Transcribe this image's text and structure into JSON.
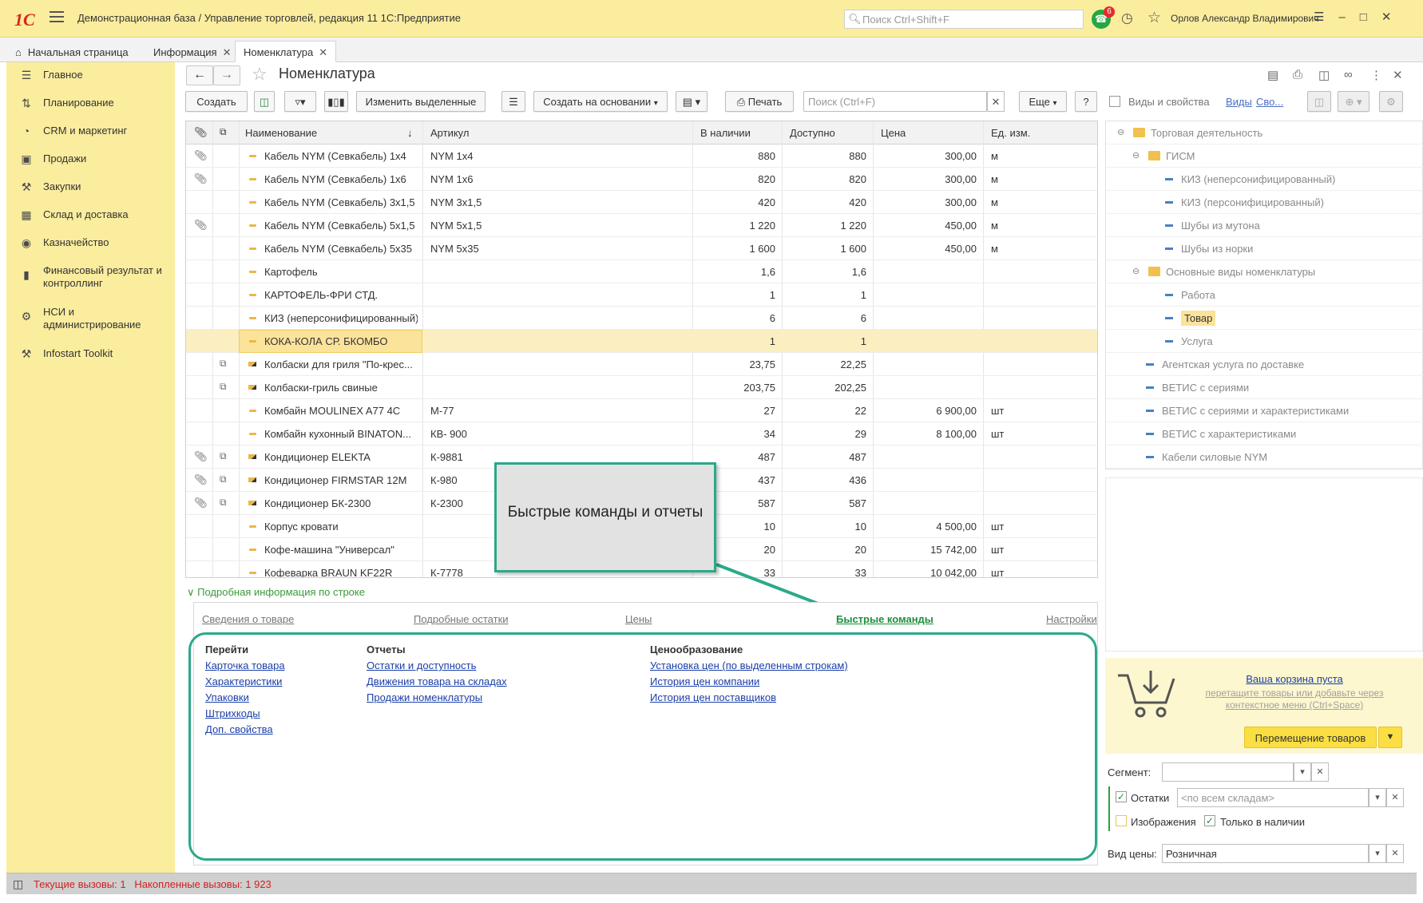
{
  "titlebar": {
    "logo": "1С",
    "title": "Демонстрационная база / Управление торговлей, редакция 11 1С:Предприятие",
    "search_placeholder": "Поиск Ctrl+Shift+F",
    "notif_count": "6",
    "user": "Орлов Александр Владимирович"
  },
  "tabs": [
    {
      "label": "Начальная страница"
    },
    {
      "label": "Информация"
    },
    {
      "label": "Номенклатура"
    }
  ],
  "sidebar": {
    "items": [
      {
        "label": "Главное",
        "icon": "list-icon"
      },
      {
        "label": "Планирование",
        "icon": "planning-icon"
      },
      {
        "label": "CRM и маркетинг",
        "icon": "pie-icon"
      },
      {
        "label": "Продажи",
        "icon": "bag-icon"
      },
      {
        "label": "Закупки",
        "icon": "cart-icon"
      },
      {
        "label": "Склад и доставка",
        "icon": "grid-icon"
      },
      {
        "label": "Казначейство",
        "icon": "coin-icon"
      },
      {
        "label": "Финансовый результат и контроллинг",
        "icon": "bar-chart-icon"
      },
      {
        "label": "НСИ и администрирование",
        "icon": "gear-icon"
      },
      {
        "label": "Infostart Toolkit",
        "icon": "tools-icon"
      }
    ]
  },
  "page": {
    "title": "Номенклатура"
  },
  "toolbar": {
    "create": "Создать",
    "edit_selected": "Изменить выделенные",
    "create_based": "Создать на основании",
    "print": "Печать",
    "search_placeholder": "Поиск (Ctrl+F)",
    "more": "Еще",
    "help": "?"
  },
  "grid": {
    "columns": [
      "Наименование",
      "Артикул",
      "В наличии",
      "Доступно",
      "Цена",
      "Ед. изм."
    ],
    "rows": [
      {
        "name": "Кабель NYM (Севкабель) 1x4",
        "art": "NYM 1x4",
        "stock": "880",
        "avail": "880",
        "price": "300,00",
        "unit": "м",
        "clip": true,
        "copy": false,
        "set": false
      },
      {
        "name": "Кабель NYM (Севкабель) 1x6",
        "art": "NYM 1x6",
        "stock": "820",
        "avail": "820",
        "price": "300,00",
        "unit": "м",
        "clip": true,
        "copy": false,
        "set": false
      },
      {
        "name": "Кабель NYM (Севкабель) 3x1,5",
        "art": "NYM 3x1,5",
        "stock": "420",
        "avail": "420",
        "price": "300,00",
        "unit": "м",
        "clip": false,
        "copy": false,
        "set": false
      },
      {
        "name": "Кабель NYM (Севкабель) 5x1,5",
        "art": "NYM 5x1,5",
        "stock": "1 220",
        "avail": "1 220",
        "price": "450,00",
        "unit": "м",
        "clip": true,
        "copy": false,
        "set": false
      },
      {
        "name": "Кабель NYM (Севкабель) 5x35",
        "art": "NYM 5x35",
        "stock": "1 600",
        "avail": "1 600",
        "price": "450,00",
        "unit": "м",
        "clip": false,
        "copy": false,
        "set": false
      },
      {
        "name": "Картофель",
        "art": "",
        "stock": "1,6",
        "avail": "1,6",
        "price": "",
        "unit": "",
        "clip": false,
        "copy": false,
        "set": false
      },
      {
        "name": "КАРТОФЕЛЬ-ФРИ СТД.",
        "art": "",
        "stock": "1",
        "avail": "1",
        "price": "",
        "unit": "",
        "clip": false,
        "copy": false,
        "set": false
      },
      {
        "name": "КИЗ (неперсонифицированный)",
        "art": "",
        "stock": "6",
        "avail": "6",
        "price": "",
        "unit": "",
        "clip": false,
        "copy": false,
        "set": false
      },
      {
        "name": "КОКА-КОЛА СР. БКОМБО",
        "art": "",
        "stock": "1",
        "avail": "1",
        "price": "",
        "unit": "",
        "clip": false,
        "copy": false,
        "set": false,
        "selected": true
      },
      {
        "name": "Колбаски для гриля \"По-крес...",
        "art": "",
        "stock": "23,75",
        "avail": "22,25",
        "price": "",
        "unit": "",
        "clip": false,
        "copy": true,
        "set": true
      },
      {
        "name": "Колбаски-гриль свиные",
        "art": "",
        "stock": "203,75",
        "avail": "202,25",
        "price": "",
        "unit": "",
        "clip": false,
        "copy": true,
        "set": true
      },
      {
        "name": "Комбайн MOULINEX  A77 4C",
        "art": "М-77",
        "stock": "27",
        "avail": "22",
        "price": "6 900,00",
        "unit": "шт",
        "clip": false,
        "copy": false,
        "set": false
      },
      {
        "name": "Комбайн кухонный BINATON...",
        "art": "КВ- 900",
        "stock": "34",
        "avail": "29",
        "price": "8 100,00",
        "unit": "шт",
        "clip": false,
        "copy": false,
        "set": false
      },
      {
        "name": "Кондиционер ELEKTA",
        "art": "К-9881",
        "stock": "487",
        "avail": "487",
        "price": "",
        "unit": "",
        "clip": true,
        "copy": true,
        "set": true
      },
      {
        "name": "Кондиционер FIRMSTAR 12M",
        "art": "К-980",
        "stock": "437",
        "avail": "436",
        "price": "",
        "unit": "",
        "clip": true,
        "copy": true,
        "set": true
      },
      {
        "name": "Кондиционер БК-2300",
        "art": "К-2300",
        "stock": "587",
        "avail": "587",
        "price": "",
        "unit": "",
        "clip": true,
        "copy": true,
        "set": true
      },
      {
        "name": "Корпус кровати",
        "art": "",
        "stock": "10",
        "avail": "10",
        "price": "4 500,00",
        "unit": "шт",
        "clip": false,
        "copy": false,
        "set": false
      },
      {
        "name": "Кофе-машина \"Универсал\"",
        "art": "",
        "stock": "20",
        "avail": "20",
        "price": "15 742,00",
        "unit": "шт",
        "clip": false,
        "copy": false,
        "set": false
      },
      {
        "name": "Кофеварка BRAUN KF22R",
        "art": "К-7778",
        "stock": "33",
        "avail": "33",
        "price": "10 042,00",
        "unit": "шт",
        "clip": false,
        "copy": false,
        "set": false
      }
    ]
  },
  "callout": {
    "text": "Быстрые команды и отчеты"
  },
  "detail": {
    "header": "Подробная информация по строке",
    "tabs": [
      "Сведения о товаре",
      "Подробные остатки",
      "Цены",
      "Быстрые команды",
      "Настройки"
    ],
    "groups": [
      {
        "title": "Перейти",
        "links": [
          "Карточка товара",
          "Характеристики",
          "Упаковки",
          "Штрихкоды",
          "Доп. свойства"
        ]
      },
      {
        "title": "Отчеты",
        "links": [
          "Остатки и доступность",
          "Движения товара на складах",
          "Продажи номенклатуры"
        ]
      },
      {
        "title": "Ценообразование",
        "links": [
          "Установка цен (по выделенным строкам)",
          "История цен компании",
          "История цен поставщиков"
        ]
      }
    ]
  },
  "rightpanel": {
    "header": "Виды и свойства",
    "link1": "Виды",
    "link2": "Сво...",
    "tree": [
      {
        "label": "Торговая деятельность",
        "level": 0,
        "type": "folder",
        "minus": true
      },
      {
        "label": "ГИСМ",
        "level": 1,
        "type": "folder",
        "minus": true
      },
      {
        "label": "КИЗ (неперсонифицированный)",
        "level": 2,
        "type": "item"
      },
      {
        "label": "КИЗ (персонифицированный)",
        "level": 2,
        "type": "item"
      },
      {
        "label": "Шубы из мутона",
        "level": 2,
        "type": "item"
      },
      {
        "label": "Шубы из норки",
        "level": 2,
        "type": "item"
      },
      {
        "label": "Основные виды номенклатуры",
        "level": 1,
        "type": "folder",
        "minus": true
      },
      {
        "label": "Работа",
        "level": 2,
        "type": "item"
      },
      {
        "label": "Товар",
        "level": 2,
        "type": "item",
        "selected": true
      },
      {
        "label": "Услуга",
        "level": 2,
        "type": "item"
      },
      {
        "label": "Агентская услуга по доставке",
        "level": 1,
        "type": "item"
      },
      {
        "label": "ВЕТИС с сериями",
        "level": 1,
        "type": "item"
      },
      {
        "label": "ВЕТИС с сериями и характеристиками",
        "level": 1,
        "type": "item"
      },
      {
        "label": "ВЕТИС с характеристиками",
        "level": 1,
        "type": "item"
      },
      {
        "label": "Кабели силовые NYM",
        "level": 1,
        "type": "item"
      }
    ],
    "cart_msg": "Ваша корзина пуста",
    "cart_sub": "перетащите товары или добавьте через контекстное меню (Ctrl+Space)",
    "move_button": "Перемещение товаров",
    "segment_label": "Сегмент:",
    "stock_label": "Остатки",
    "stock_placeholder": "<по всем складам>",
    "images_label": "Изображения",
    "only_avail_label": "Только в наличии",
    "price_type_label": "Вид цены:",
    "price_type_value": "Розничная"
  },
  "status": {
    "text": "Текущие вызовы: 1   Накопленные вызовы: 1 923"
  },
  "colors": {
    "accent_yellow": "#fbed9e",
    "callout_green": "#2ba98a",
    "link_blue": "#1a3fa8",
    "selected_row": "#fbeec1"
  }
}
